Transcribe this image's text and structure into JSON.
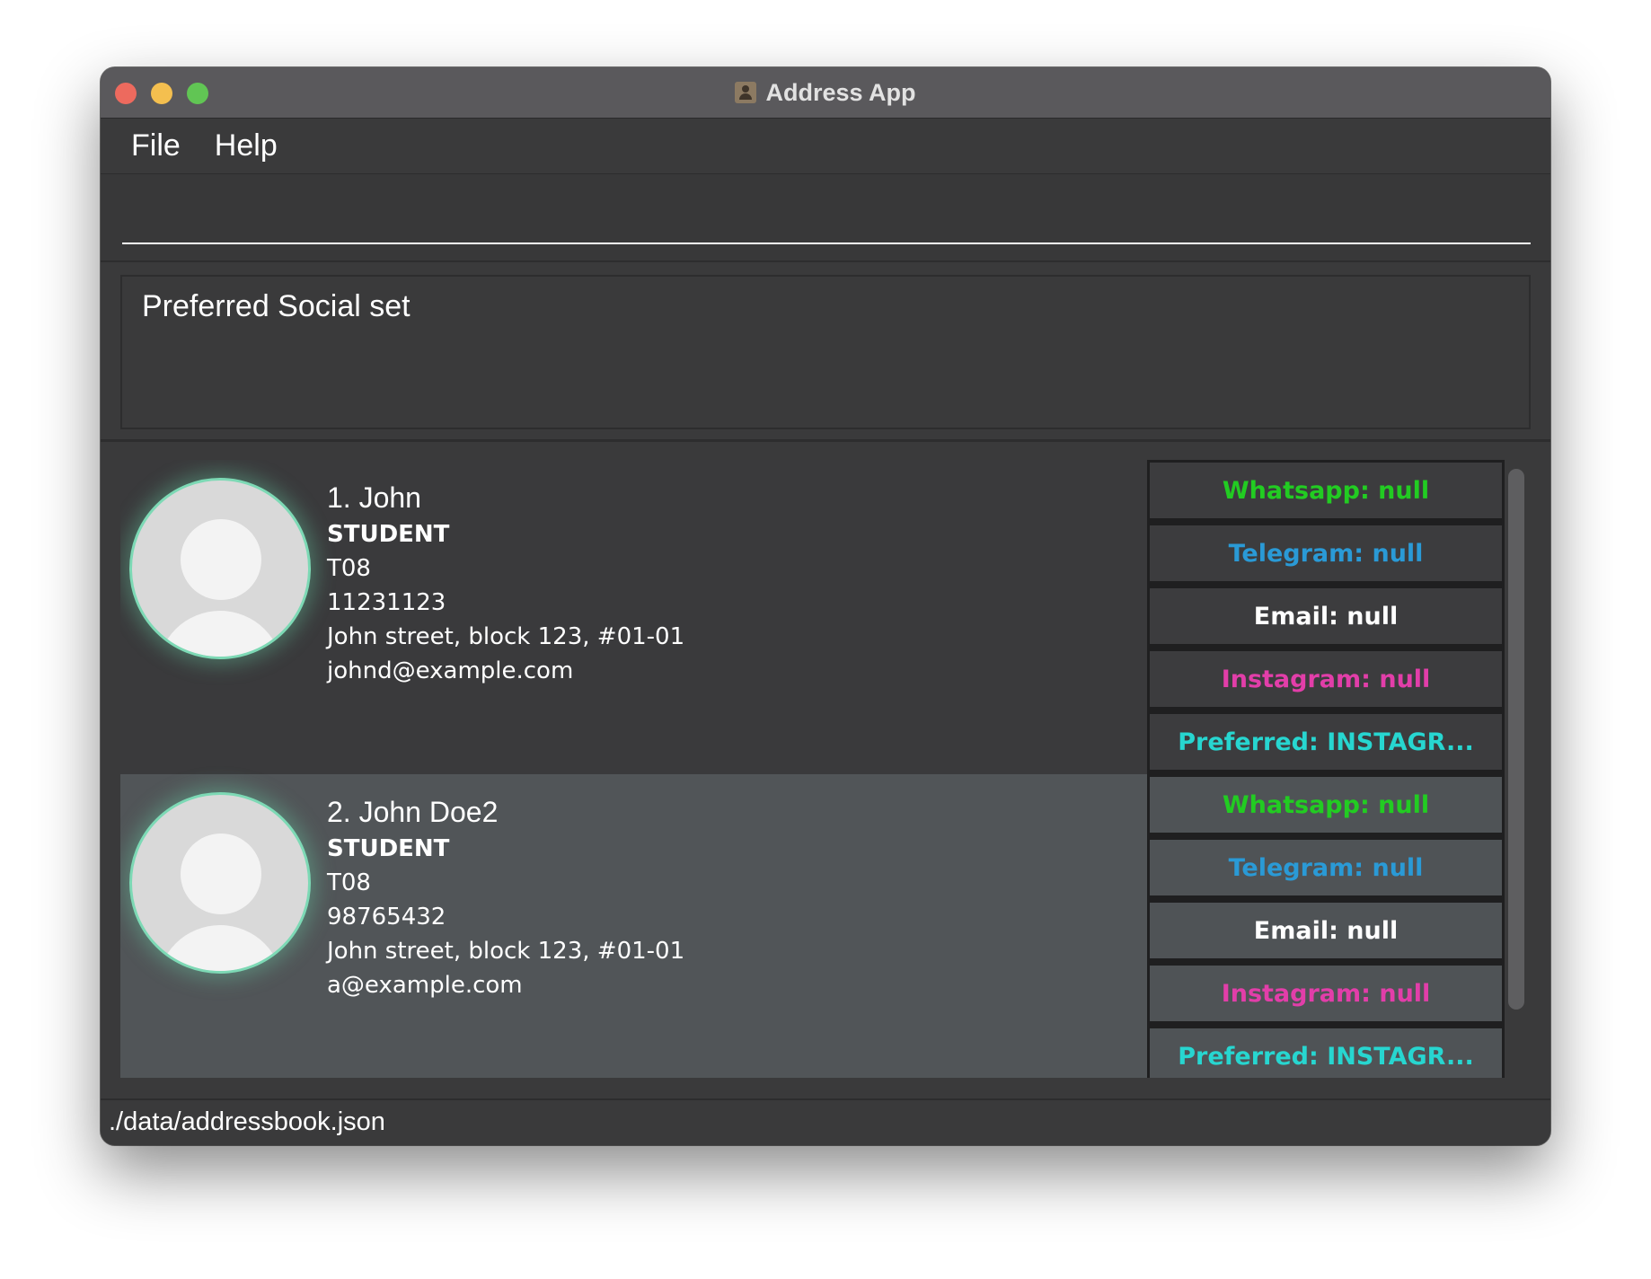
{
  "window": {
    "title": "Address App",
    "title_icon": "address-book-icon"
  },
  "menu": {
    "items": [
      "File",
      "Help"
    ]
  },
  "command": {
    "value": "",
    "placeholder": ""
  },
  "result": {
    "text": "Preferred Social set"
  },
  "persons": [
    {
      "index_name": "1.  John",
      "role": "STUDENT",
      "tutorial": "T08",
      "phone": "11231123",
      "address": "John street, block 123, #01-01",
      "email": "johnd@example.com",
      "socials": [
        {
          "label": "Whatsapp: null",
          "color": "#22cc22"
        },
        {
          "label": "Telegram: null",
          "color": "#2a9ad6"
        },
        {
          "label": "Email: null",
          "color": "#ffffff"
        },
        {
          "label": "Instagram: null",
          "color": "#e23ea9"
        },
        {
          "label": "Preferred: INSTAGR...",
          "color": "#27d6d0"
        }
      ]
    },
    {
      "index_name": "2.  John Doe2",
      "role": "STUDENT",
      "tutorial": "T08",
      "phone": "98765432",
      "address": "John street, block 123, #01-01",
      "email": "a@example.com",
      "socials": [
        {
          "label": "Whatsapp: null",
          "color": "#22cc22"
        },
        {
          "label": "Telegram: null",
          "color": "#2a9ad6"
        },
        {
          "label": "Email: null",
          "color": "#ffffff"
        },
        {
          "label": "Instagram: null",
          "color": "#e23ea9"
        },
        {
          "label": "Preferred: INSTAGR...",
          "color": "#27d6d0"
        }
      ]
    }
  ],
  "status": {
    "path": "./data/addressbook.json"
  },
  "colors": {
    "accent_avatar_ring": "#7dd9b5",
    "traffic_close": "#ed6a5e",
    "traffic_minimize": "#f4bf4f",
    "traffic_maximize": "#61c554"
  }
}
